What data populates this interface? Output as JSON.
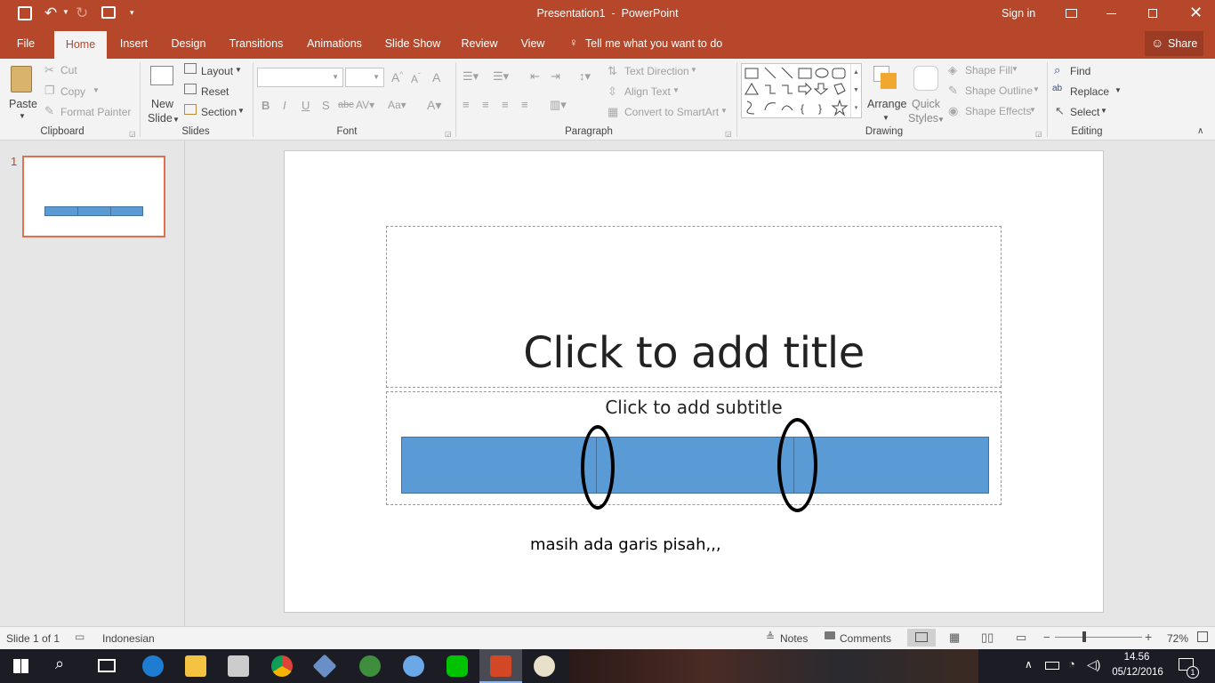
{
  "title": {
    "doc": "Presentation1  -  PowerPoint",
    "signin": "Sign in"
  },
  "tabs": [
    "File",
    "Home",
    "Insert",
    "Design",
    "Transitions",
    "Animations",
    "Slide Show",
    "Review",
    "View"
  ],
  "tell_me": "Tell me what you want to do",
  "share": "Share",
  "clipboard": {
    "paste": "Paste",
    "cut": "Cut",
    "copy": "Copy",
    "format_painter": "Format Painter",
    "label": "Clipboard"
  },
  "slides_grp": {
    "new": "New",
    "slide": "Slide",
    "layout": "Layout",
    "reset": "Reset",
    "section": "Section",
    "label": "Slides"
  },
  "font_grp": {
    "label": "Font",
    "bold": "B",
    "italic": "I",
    "underline": "U",
    "shadow": "S",
    "strike": "abc"
  },
  "paragraph_grp": {
    "label": "Paragraph",
    "text_direction": "Text Direction",
    "align_text": "Align Text",
    "smartart": "Convert to SmartArt"
  },
  "drawing_grp": {
    "label": "Drawing",
    "arrange": "Arrange",
    "quick": "Quick",
    "styles": "Styles",
    "shape_fill": "Shape Fill",
    "shape_outline": "Shape Outline",
    "shape_effects": "Shape Effects"
  },
  "editing_grp": {
    "label": "Editing",
    "find": "Find",
    "replace": "Replace",
    "select": "Select"
  },
  "thumb_number": "1",
  "slide": {
    "title_placeholder": "Click to add title",
    "subtitle_placeholder": "Click to add subtitle",
    "note_text": "masih ada garis pisah,,,"
  },
  "status": {
    "slide_of": "Slide 1 of 1",
    "language": "Indonesian",
    "notes": "Notes",
    "comments": "Comments",
    "zoom": "72%"
  },
  "taskbar": {
    "time": "14.56",
    "date": "05/12/2016",
    "notif_count": "1"
  },
  "colors": {
    "accent": "#b7472a",
    "shape_fill": "#5b9bd5",
    "shape_border": "#41719c"
  }
}
